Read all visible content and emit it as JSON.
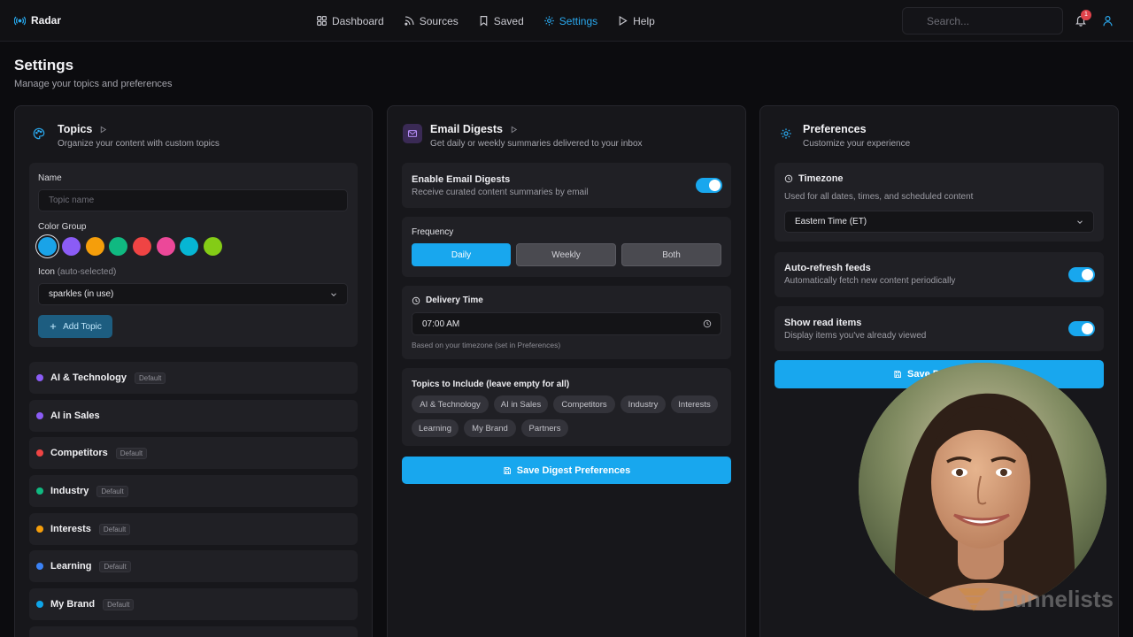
{
  "app": {
    "name": "Radar"
  },
  "nav": [
    {
      "label": "Dashboard",
      "icon": "grid-icon",
      "active": false
    },
    {
      "label": "Sources",
      "icon": "rss-icon",
      "active": false
    },
    {
      "label": "Saved",
      "icon": "bookmark-icon",
      "active": false
    },
    {
      "label": "Settings",
      "icon": "gear-icon",
      "active": true
    },
    {
      "label": "Help",
      "icon": "play-icon",
      "active": false
    }
  ],
  "search": {
    "placeholder": "Search..."
  },
  "notifications": {
    "count": "1"
  },
  "page": {
    "title": "Settings",
    "subtitle": "Manage your topics and preferences"
  },
  "topics": {
    "title": "Topics",
    "subtitle": "Organize your content with custom topics",
    "name_label": "Name",
    "name_placeholder": "Topic name",
    "color_group_label": "Color Group",
    "colors": [
      "#1aa3e8",
      "#8b5cf6",
      "#f59e0b",
      "#10b981",
      "#ef4444",
      "#ec4899",
      "#06b6d4",
      "#84cc16"
    ],
    "icon_label": "Icon",
    "icon_hint": "(auto-selected)",
    "icon_value": "sparkles (in use)",
    "add_button": "Add Topic",
    "default_badge": "Default",
    "list": [
      {
        "name": "AI & Technology",
        "color": "#8b5cf6",
        "default": true
      },
      {
        "name": "AI in Sales",
        "color": "#8b5cf6",
        "default": false
      },
      {
        "name": "Competitors",
        "color": "#ef4444",
        "default": true
      },
      {
        "name": "Industry",
        "color": "#10b981",
        "default": true
      },
      {
        "name": "Interests",
        "color": "#f59e0b",
        "default": true
      },
      {
        "name": "Learning",
        "color": "#3b82f6",
        "default": true
      },
      {
        "name": "My Brand",
        "color": "#0ea5e9",
        "default": true
      }
    ]
  },
  "digests": {
    "title": "Email Digests",
    "subtitle": "Get daily or weekly summaries delivered to your inbox",
    "enable_title": "Enable Email Digests",
    "enable_sub": "Receive curated content summaries by email",
    "enabled": true,
    "frequency_label": "Frequency",
    "frequency_options": [
      "Daily",
      "Weekly",
      "Both"
    ],
    "frequency_selected": "Daily",
    "delivery_label": "Delivery Time",
    "delivery_value": "07:00 AM",
    "delivery_hint": "Based on your timezone (set in Preferences)",
    "include_label": "Topics to Include (leave empty for all)",
    "include_topics": [
      "AI & Technology",
      "AI in Sales",
      "Competitors",
      "Industry",
      "Interests",
      "Learning",
      "My Brand",
      "Partners"
    ],
    "save_button": "Save Digest Preferences"
  },
  "preferences": {
    "title": "Preferences",
    "subtitle": "Customize your experience",
    "timezone_label": "Timezone",
    "timezone_hint": "Used for all dates, times, and scheduled content",
    "timezone_value": "Eastern Time (ET)",
    "autorefresh_title": "Auto-refresh feeds",
    "autorefresh_sub": "Automatically fetch new content periodically",
    "autorefresh_on": true,
    "showread_title": "Show read items",
    "showread_sub": "Display items you've already viewed",
    "showread_on": true,
    "save_button": "Save P"
  },
  "watermark": {
    "text": "Funnelists"
  },
  "colors": {
    "accent": "#18a7ee",
    "background": "#0c0c0f",
    "card": "#17171b",
    "panel": "#202025"
  }
}
